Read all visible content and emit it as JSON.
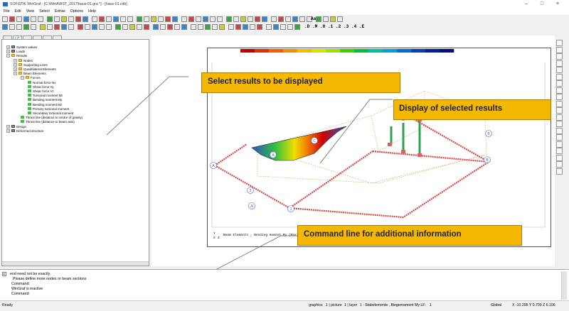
{
  "window": {
    "title": "SOFiSTiK WinGraf - [C:\\WinA\\RST_2017\\haus-01.gra *] - [haus-01.cdb]",
    "minimize": "–",
    "maximize": "□",
    "close": "×"
  },
  "menu": [
    "File",
    "Edit",
    "View",
    "Select",
    "Extras",
    "Options",
    "Help"
  ],
  "toolbar": {
    "page_label_aa": "Aa",
    "scale_labels": [
      ".D",
      ".M",
      ".0",
      ".1",
      ".2",
      ".3",
      ".4",
      ".E"
    ]
  },
  "tree": {
    "tabs": [
      "LC"
    ],
    "nodes": [
      {
        "label": "System values",
        "level": 0,
        "exp": "+",
        "icon": "struct"
      },
      {
        "label": "Loads",
        "level": 0,
        "exp": "+",
        "icon": "struct"
      },
      {
        "label": "Results",
        "level": 0,
        "exp": "−",
        "icon": "fold"
      },
      {
        "label": "Nodes",
        "level": 1,
        "exp": "+",
        "icon": "fold"
      },
      {
        "label": "Supporting Lines",
        "level": 1,
        "exp": "+",
        "icon": "fold"
      },
      {
        "label": "Quadrilateral Elements",
        "level": 1,
        "exp": "+",
        "icon": "fold"
      },
      {
        "label": "Beam Elements",
        "level": 1,
        "exp": "−",
        "icon": "fold"
      },
      {
        "label": "Forces",
        "level": 2,
        "exp": "−",
        "icon": "fold"
      },
      {
        "label": "Normal force Nx",
        "level": 3,
        "exp": "",
        "icon": "green"
      },
      {
        "label": "Shear force Vy",
        "level": 3,
        "exp": "",
        "icon": "green"
      },
      {
        "label": "Shear force Vz",
        "level": 3,
        "exp": "",
        "icon": "green"
      },
      {
        "label": "Torsional moment Mt",
        "level": 3,
        "exp": "",
        "icon": "green"
      },
      {
        "label": "Bending moment My",
        "level": 3,
        "exp": "",
        "icon": "green"
      },
      {
        "label": "Bending moment Mz",
        "level": 3,
        "exp": "",
        "icon": "green"
      },
      {
        "label": "Primary torsional moment",
        "level": 3,
        "exp": "",
        "icon": "green"
      },
      {
        "label": "Secondary torsional moment",
        "level": 3,
        "exp": "",
        "icon": "green"
      },
      {
        "label": "Thrust line (distance to centre of gravity)",
        "level": 2,
        "exp": "",
        "icon": "green"
      },
      {
        "label": "Thrust line (distance to beam axis)",
        "level": 2,
        "exp": "",
        "icon": "green"
      },
      {
        "label": "Design",
        "level": 0,
        "exp": "+",
        "icon": "struct"
      },
      {
        "label": "Deformed structure",
        "level": 0,
        "exp": "+",
        "icon": "struct"
      }
    ]
  },
  "drawing": {
    "caption": "Beam Elements , Bending moment My (Maximum",
    "axis_label": "Y",
    "axis_label2": "X",
    "axis_label3": "Z",
    "color_colors": [
      "#c00000",
      "#e03000",
      "#f06000",
      "#f09000",
      "#f0c000",
      "#e0e000",
      "#a0e000",
      "#40d000",
      "#00c040",
      "#00c0a0",
      "#00a0e0",
      "#0070e0",
      "#0040c0",
      "#0020a0",
      "#001080"
    ],
    "node_labels": [
      "A",
      "A",
      "A",
      "B",
      "B",
      "C",
      "1",
      "2",
      "3"
    ]
  },
  "callouts": {
    "select": "Select results to be displayed",
    "display": "Display of selected results",
    "command": "Command line for additional information"
  },
  "command": {
    "lines": [
      "end need not be exactly.",
      "Please define more nodes or beam sections",
      "Command:",
      "WinGraf is inactive",
      "Command:"
    ]
  },
  "status": {
    "ready": "Ready",
    "graphics": "graphics",
    "picture": "1 | picture",
    "layer": "1 | layer",
    "lc": "1 : Stabelemente , Biegemoment My  LF:",
    "lc_value": "1",
    "global": "Global",
    "coords": "X -10.295  Y 0.709   Z 6.106"
  }
}
